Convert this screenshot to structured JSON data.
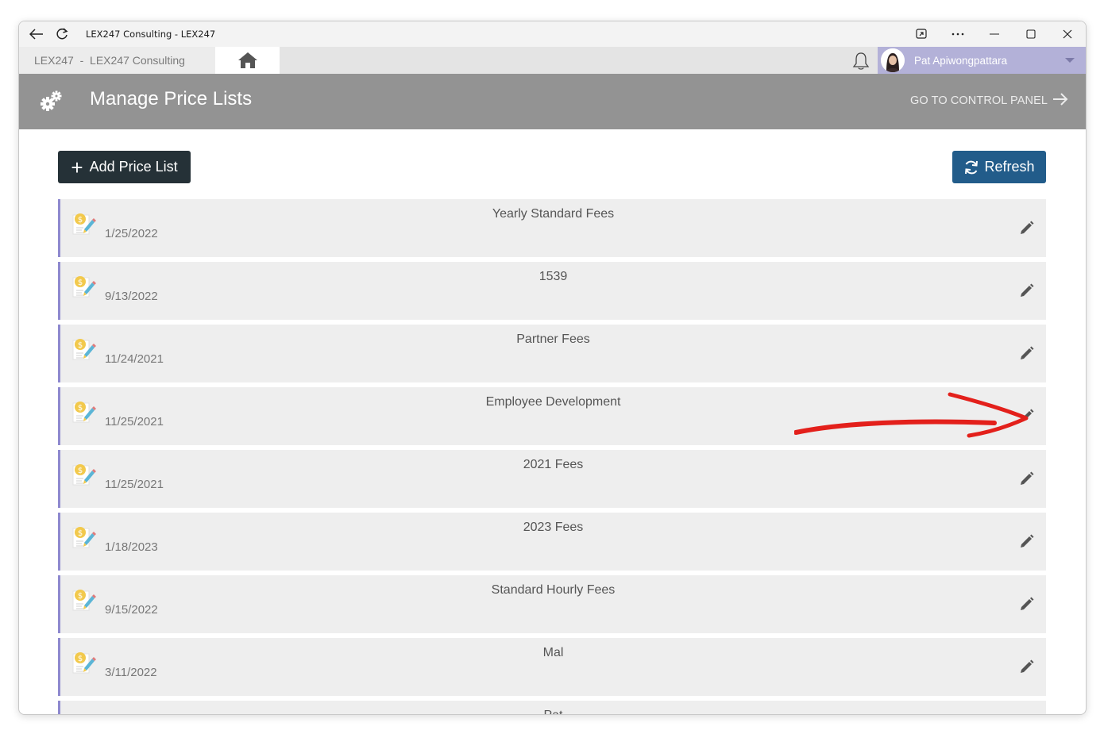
{
  "window": {
    "title": "LEX247 Consulting - LEX247"
  },
  "app_header": {
    "breadcrumb": "LEX247  -  LEX247 Consulting",
    "user_name": "Pat Apiwongpattara"
  },
  "page": {
    "title": "Manage Price Lists",
    "control_panel_link": "GO TO CONTROL PANEL"
  },
  "toolbar": {
    "add_label": "Add Price List",
    "refresh_label": "Refresh"
  },
  "price_lists": [
    {
      "name": "Yearly Standard Fees",
      "date": "1/25/2022"
    },
    {
      "name": "1539",
      "date": "9/13/2022"
    },
    {
      "name": "Partner Fees",
      "date": "11/24/2021"
    },
    {
      "name": "Employee Development",
      "date": "11/25/2021"
    },
    {
      "name": "2021 Fees",
      "date": "11/25/2021"
    },
    {
      "name": "2023 Fees",
      "date": "1/18/2023"
    },
    {
      "name": "Standard Hourly Fees",
      "date": "9/15/2022"
    },
    {
      "name": "Mal",
      "date": "3/11/2022"
    },
    {
      "name": "Pat",
      "date": ""
    }
  ],
  "colors": {
    "header_band": "#939393",
    "add_button": "#253137",
    "refresh_button": "#225c8a",
    "row_accent": "#8e89cf",
    "user_box": "#b3b1d8",
    "annotation_arrow": "#e3201b"
  },
  "icons": {
    "back": "back-arrow-icon",
    "reload": "reload-icon",
    "home": "home-icon",
    "bell": "bell-icon",
    "settings": "gears-icon",
    "row": "price-document-icon",
    "edit": "pencil-icon"
  }
}
